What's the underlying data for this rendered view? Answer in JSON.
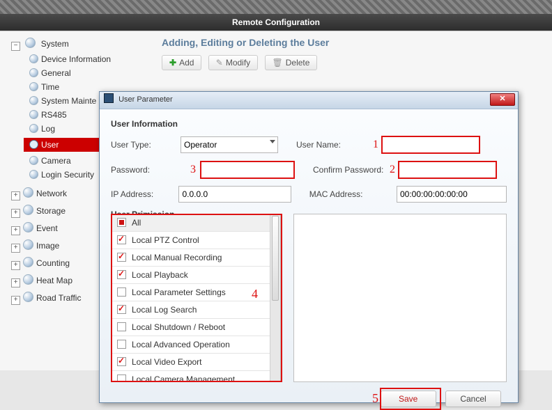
{
  "window_title": "Remote Configuration",
  "tree": {
    "system": {
      "label": "System",
      "expanded": true,
      "children": [
        {
          "label": "Device Information"
        },
        {
          "label": "General"
        },
        {
          "label": "Time"
        },
        {
          "label": "System Mainte"
        },
        {
          "label": "RS485"
        },
        {
          "label": "Log"
        },
        {
          "label": "User",
          "selected": true
        },
        {
          "label": "Camera"
        },
        {
          "label": "Login Security"
        }
      ]
    },
    "items": [
      {
        "label": "Network"
      },
      {
        "label": "Storage"
      },
      {
        "label": "Event"
      },
      {
        "label": "Image"
      },
      {
        "label": "Counting"
      },
      {
        "label": "Heat Map"
      },
      {
        "label": "Road Traffic"
      }
    ]
  },
  "page": {
    "heading": "Adding, Editing or Deleting the User",
    "btn_add": "Add",
    "btn_modify": "Modify",
    "btn_delete": "Delete"
  },
  "dialog": {
    "title": "User Parameter",
    "section1": "User Information",
    "user_type_label": "User Type:",
    "user_type_value": "Operator",
    "user_name_label": "User Name:",
    "user_name_value": "",
    "password_label": "Password:",
    "password_value": "",
    "confirm_label": "Confirm Password:",
    "confirm_value": "",
    "ip_label": "IP Address:",
    "ip_value": "0.0.0.0",
    "mac_label": "MAC Address:",
    "mac_value": "00:00:00:00:00:00",
    "section2": "User Primission",
    "permissions": [
      {
        "label": "All",
        "state": "full"
      },
      {
        "label": "Local PTZ Control",
        "state": "chk"
      },
      {
        "label": "Local Manual Recording",
        "state": "chk"
      },
      {
        "label": "Local Playback",
        "state": "chk"
      },
      {
        "label": "Local Parameter Settings",
        "state": "off"
      },
      {
        "label": "Local Log Search",
        "state": "chk"
      },
      {
        "label": "Local Shutdown / Reboot",
        "state": "off"
      },
      {
        "label": "Local Advanced Operation",
        "state": "off"
      },
      {
        "label": "Local Video Export",
        "state": "chk"
      },
      {
        "label": "Local Camera Management",
        "state": "off"
      }
    ],
    "save": "Save",
    "cancel": "Cancel"
  },
  "annotations": {
    "n1": "1",
    "n2": "2",
    "n3": "3",
    "n4": "4",
    "n5": "5"
  }
}
